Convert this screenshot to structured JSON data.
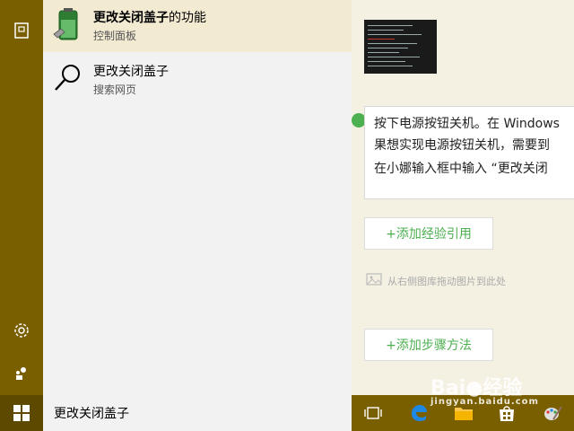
{
  "search": {
    "query": "更改关闭盖子"
  },
  "results": [
    {
      "title_bold": "更改关闭盖子",
      "title_rest": "的功能",
      "subtitle": "控制面板",
      "icon": "battery-icon"
    },
    {
      "title_bold": "更改关闭盖子",
      "title_rest": "",
      "subtitle": "搜索网页",
      "icon": "search-icon"
    }
  ],
  "page": {
    "text_lines": [
      "按下电源按钮关机。在 Windows",
      "果想实现电源按钮关机，需要到",
      "在小娜输入框中输入 “更改关闭"
    ],
    "add_reference_label": "+添加经验引用",
    "drag_hint": "从右侧图库拖动图片到此处",
    "add_step_label": "+添加步骤方法"
  },
  "watermark": {
    "brand": "Bai",
    "brand2": "经验",
    "domain": "jingyan.baidu.com"
  },
  "colors": {
    "accent": "#7a5f00",
    "selected": "#f3ead2",
    "green": "#4caf50"
  }
}
